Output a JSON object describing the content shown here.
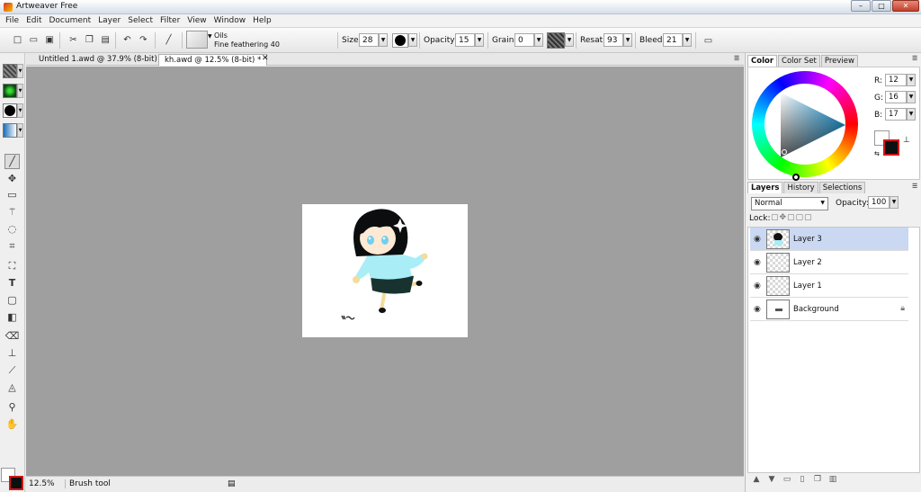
{
  "window": {
    "title": "Artweaver Free",
    "controls": [
      "–",
      "□",
      "✕"
    ]
  },
  "menu": [
    "File",
    "Edit",
    "Document",
    "Layer",
    "Select",
    "Filter",
    "View",
    "Window",
    "Help"
  ],
  "toolbar": {
    "preset_brush": "Oils",
    "preset_variant": "Fine feathering 40",
    "size_label": "Size:",
    "size_value": "28",
    "opacity_label": "Opacity:",
    "opacity_value": "15",
    "grain_label": "Grain:",
    "grain_value": "0",
    "resat_label": "Resat:",
    "resat_value": "93",
    "bleed_label": "Bleed:",
    "bleed_value": "21"
  },
  "tabs": [
    {
      "label": "Untitled 1.awd @ 37.9% (8-bit)",
      "active": false
    },
    {
      "label": "kh.awd @ 12.5% (8-bit) *",
      "active": true
    }
  ],
  "status": {
    "zoom": "12.5%",
    "tool": "Brush tool"
  },
  "color_panel": {
    "tabs": [
      "Color",
      "Color Set",
      "Preview"
    ],
    "r_label": "R:",
    "r_value": "12",
    "g_label": "G:",
    "g_value": "16",
    "b_label": "B:",
    "b_value": "17",
    "foreground": "#ffffff",
    "background": "#0c1011"
  },
  "layers_panel": {
    "tabs": [
      "Layers",
      "History",
      "Selections"
    ],
    "blend_mode": "Normal",
    "opacity_label": "Opacity:",
    "opacity_value": "100",
    "lock_label": "Lock:",
    "layers": [
      {
        "name": "Layer 3",
        "selected": true
      },
      {
        "name": "Layer 2",
        "selected": false
      },
      {
        "name": "Layer 1",
        "selected": false
      },
      {
        "name": "Background",
        "selected": false,
        "locked": true
      }
    ]
  },
  "colors": {
    "workspace": "#9f9f9f",
    "selection": "#cad8f2",
    "accent_red": "#d01818"
  }
}
